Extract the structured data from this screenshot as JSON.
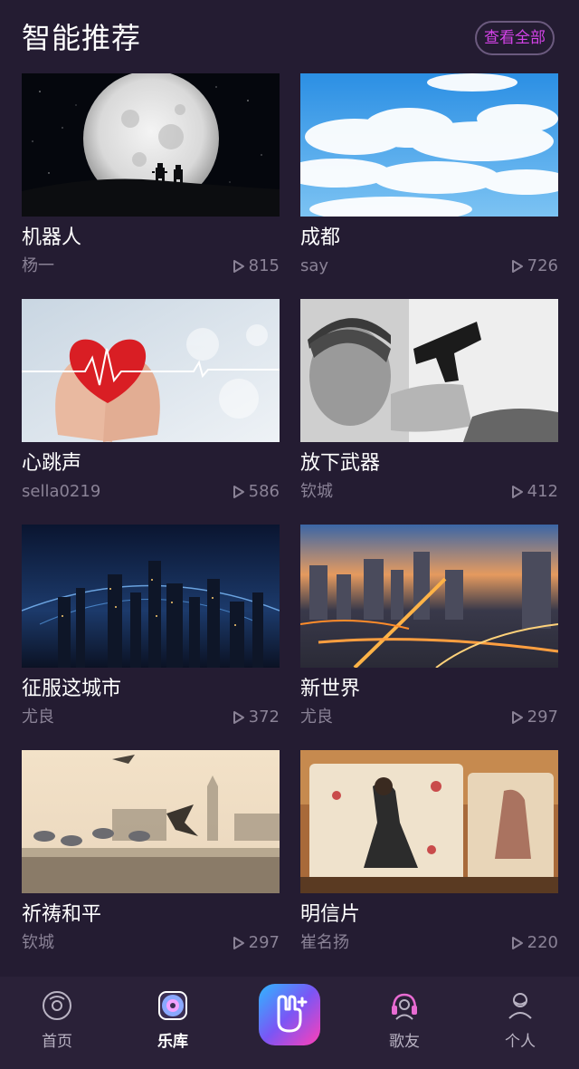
{
  "header": {
    "title": "智能推荐",
    "view_all_label": "查看全部"
  },
  "colors": {
    "background": "#241c32",
    "accent": "#d443e8",
    "muted_text": "#8a8296",
    "tabbar_bg": "#2a2138"
  },
  "cards": [
    {
      "title": "机器人",
      "author": "杨一",
      "plays": "815",
      "image": "moon-robots-image"
    },
    {
      "title": "成都",
      "author": "say",
      "plays": "726",
      "image": "sky-clouds-image"
    },
    {
      "title": "心跳声",
      "author": "sella0219",
      "plays": "586",
      "image": "heart-hands-image"
    },
    {
      "title": "放下武器",
      "author": "钦城",
      "plays": "412",
      "image": "boy-gun-image"
    },
    {
      "title": "征服这城市",
      "author": "尤良",
      "plays": "372",
      "image": "city-globe-image"
    },
    {
      "title": "新世界",
      "author": "尤良",
      "plays": "297",
      "image": "city-night-image"
    },
    {
      "title": "祈祷和平",
      "author": "钦城",
      "plays": "297",
      "image": "pigeons-london-image"
    },
    {
      "title": "明信片",
      "author": "崔名扬",
      "plays": "220",
      "image": "postcards-image"
    }
  ],
  "tabbar": {
    "items": [
      {
        "label": "首页",
        "icon": "disc-icon",
        "active": false
      },
      {
        "label": "乐库",
        "icon": "speaker-icon",
        "active": true
      },
      {
        "label": "",
        "icon": "rock-hand-icon",
        "active": false
      },
      {
        "label": "歌友",
        "icon": "headphones-person-icon",
        "active": false
      },
      {
        "label": "个人",
        "icon": "person-icon",
        "active": false
      }
    ]
  }
}
